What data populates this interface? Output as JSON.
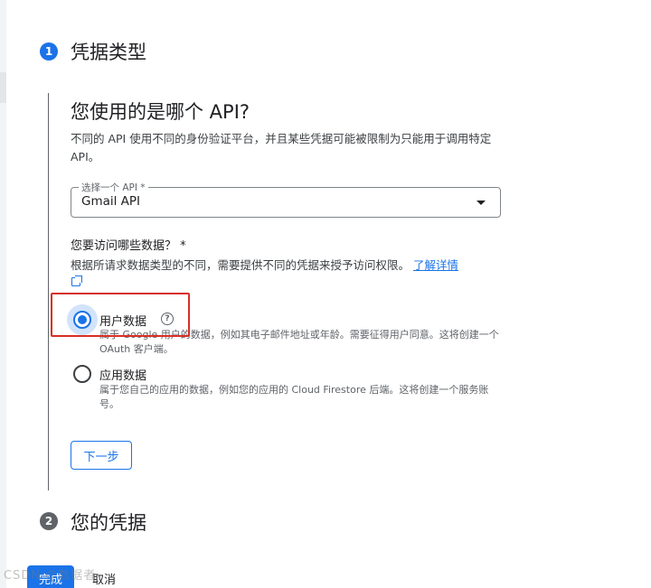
{
  "steps": [
    {
      "number": "1",
      "title": "凭据类型"
    },
    {
      "number": "2",
      "title": "您的凭据"
    }
  ],
  "api_section": {
    "heading": "您使用的是哪个 API?",
    "description": "不同的 API 使用不同的身份验证平台，并且某些凭据可能被限制为只能用于调用特定 API。",
    "select": {
      "label": "选择一个 API *",
      "value": "Gmail API"
    }
  },
  "data_section": {
    "question": "您要访问哪些数据？ *",
    "description": "根据所请求数据类型的不同，需要提供不同的凭据来授予访问权限。",
    "learn_more": "了解详情",
    "options": [
      {
        "label": "用户数据",
        "selected": true,
        "description": "属于 Google 用户的数据，例如其电子邮件地址或年龄。需要征得用户同意。这将创建一个 OAuth 客户端。"
      },
      {
        "label": "应用数据",
        "selected": false,
        "description": "属于您自己的应用的数据，例如您的应用的 Cloud Firestore 后端。这将创建一个服务账号。"
      }
    ]
  },
  "buttons": {
    "next": "下一步",
    "done": "完成",
    "cancel": "取消"
  },
  "watermark": "CSDN @数据者",
  "colors": {
    "accent": "#1a73e8",
    "highlight": "#d93025",
    "inactive": "#5f6368"
  }
}
